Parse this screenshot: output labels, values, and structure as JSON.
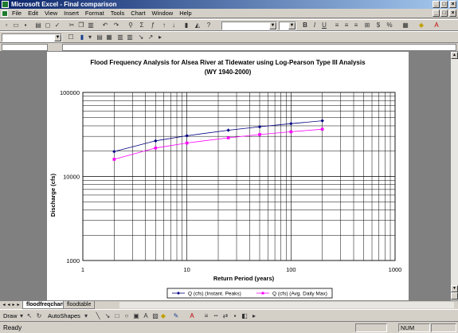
{
  "window": {
    "title": "Microsoft Excel - Final comparison"
  },
  "menu": {
    "items": [
      "File",
      "Edit",
      "View",
      "Insert",
      "Format",
      "Tools",
      "Chart",
      "Window",
      "Help"
    ]
  },
  "sheet_tabs": [
    {
      "label": "floodfreqchart",
      "active": true
    },
    {
      "label": "floodtable",
      "active": false
    }
  ],
  "drawbar": {
    "draw_label": "Draw",
    "autoshapes_label": "AutoShapes"
  },
  "status": {
    "ready": "Ready",
    "num": "NUM"
  },
  "chart_data": {
    "type": "scatter",
    "title": "Flood Frequency Analysis for Alsea River at Tidewater using Log-Pearson Type III Analysis",
    "subtitle": "(WY 1940-2000)",
    "xlabel": "Return Period (years)",
    "ylabel": "Discharge (cfs)",
    "xscale": "log",
    "yscale": "log",
    "xlim": [
      1,
      1000
    ],
    "ylim": [
      1000,
      100000
    ],
    "xticks": [
      "1",
      "10",
      "100",
      "1000"
    ],
    "yticks": [
      "1000",
      "10000",
      "100000"
    ],
    "grid": true,
    "legend_position": "bottom",
    "series": [
      {
        "name": "Q (cfs) (Instant. Peaks)",
        "color": "#000080",
        "marker": "diamond",
        "x": [
          2,
          5,
          10,
          25,
          50,
          100,
          200
        ],
        "y": [
          19800,
          26500,
          30500,
          35500,
          39000,
          42500,
          46000
        ]
      },
      {
        "name": "Q (cfs) (Avg. Daily Max)",
        "color": "#ff00ff",
        "marker": "square",
        "x": [
          2,
          5,
          10,
          25,
          50,
          100,
          200
        ],
        "y": [
          16000,
          21800,
          25000,
          28800,
          31500,
          34000,
          36500
        ]
      }
    ]
  }
}
